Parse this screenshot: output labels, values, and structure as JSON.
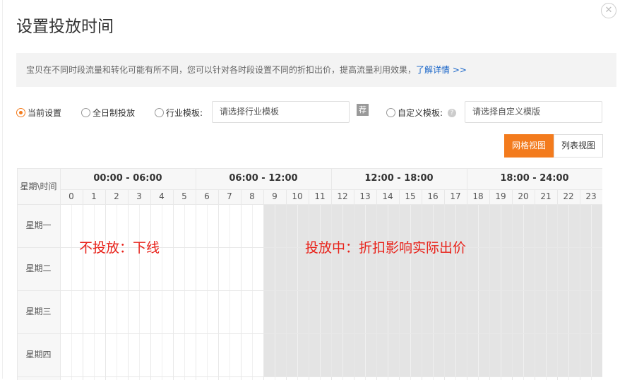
{
  "title": "设置投放时间",
  "notice": {
    "text": "宝贝在不同时段流量和转化可能有所不同，您可以针对各时段设置不同的折扣出价，提高流量利用效果，",
    "link": "了解详情 >>"
  },
  "options": {
    "current": "当前设置",
    "allday": "全日制投放",
    "industry": "行业模板:",
    "industry_placeholder": "请选择行业模板",
    "recommend": "荐",
    "custom": "自定义模板:",
    "custom_placeholder": "请选择自定义模版",
    "selected": "current"
  },
  "views": {
    "grid": "网格视图",
    "list": "列表视图",
    "active": "grid"
  },
  "table": {
    "corner": "星期\\时间",
    "ranges": [
      "00:00 - 06:00",
      "06:00 - 12:00",
      "12:00 - 18:00",
      "18:00 - 24:00"
    ],
    "hours": [
      "0",
      "1",
      "2",
      "3",
      "4",
      "5",
      "6",
      "7",
      "8",
      "9",
      "10",
      "11",
      "12",
      "13",
      "14",
      "15",
      "16",
      "17",
      "18",
      "19",
      "20",
      "21",
      "22",
      "23"
    ],
    "days": [
      "星期一",
      "星期二",
      "星期三",
      "星期四"
    ],
    "active_from_hour": 9,
    "active_to_hour": 23
  },
  "annotations": {
    "off": "不投放：下线",
    "on": "投放中：折扣影响实际出价"
  },
  "colors": {
    "accent": "#f37b1d",
    "active_cell": "#e4e4e4",
    "annotation": "#e8221a"
  }
}
